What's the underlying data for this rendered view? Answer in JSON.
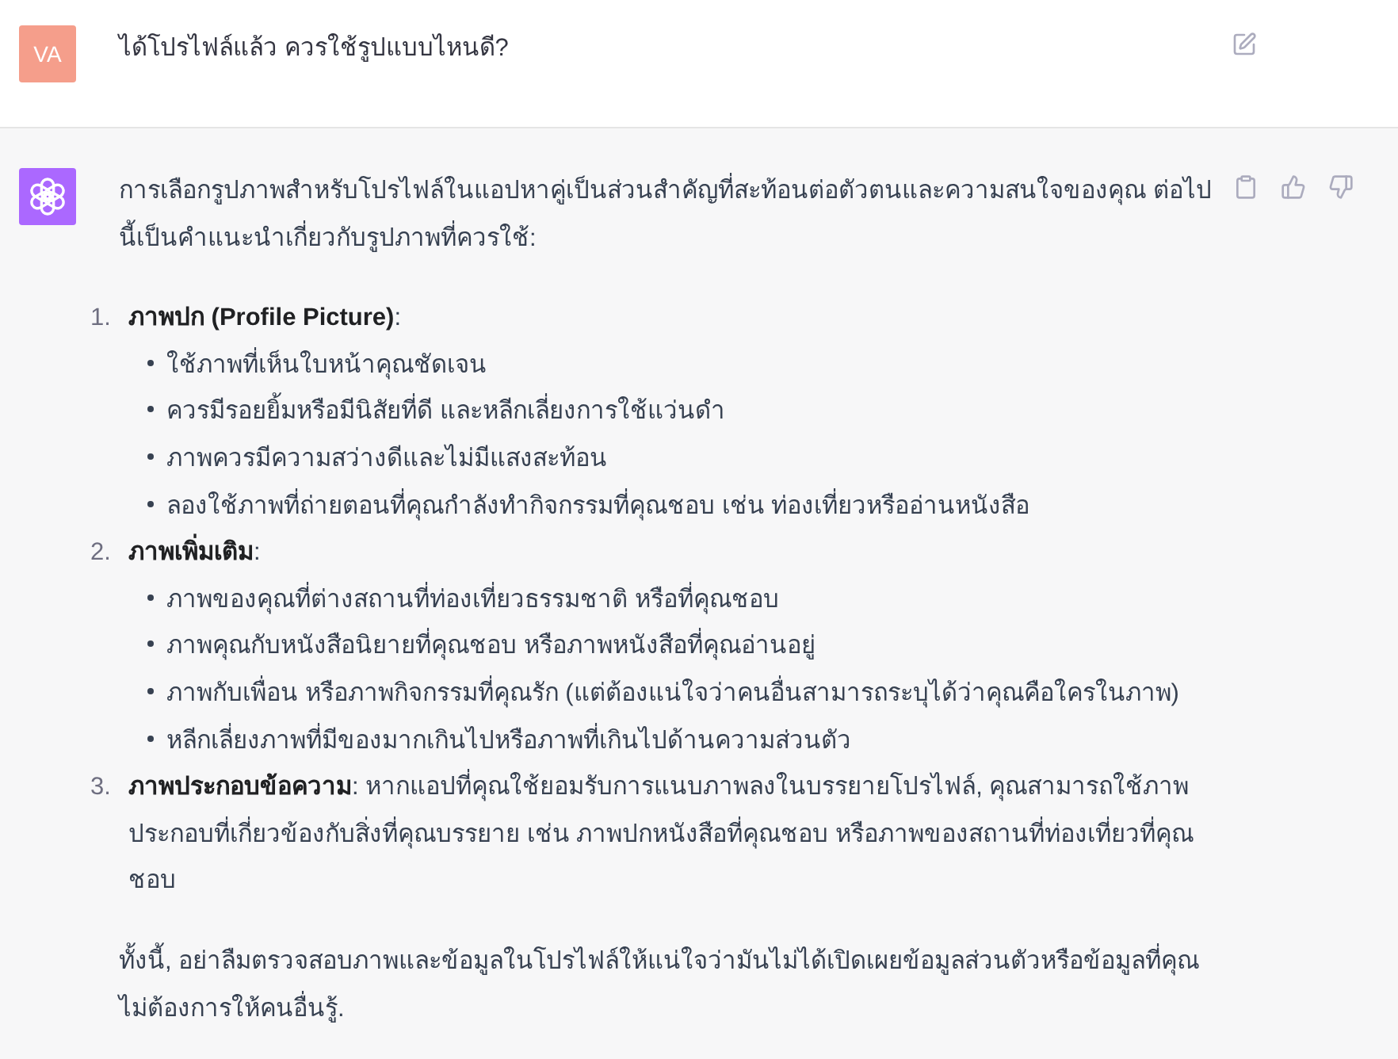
{
  "user_message": {
    "avatar": "VA",
    "text": "ได้โปรไฟล์แล้ว ควรใช้รูปแบบไหนดี?"
  },
  "assistant_message": {
    "intro": "การเลือกรูปภาพสำหรับโปรไฟล์ในแอปหาคู่เป็นส่วนสำคัญที่สะท้อนต่อตัวตนและความสนใจของคุณ ต่อไปนี้เป็นคำแนะนำเกี่ยวกับรูปภาพที่ควรใช้:",
    "list": [
      {
        "number": "1.",
        "text": "**ภาพปก (Profile Picture)**:",
        "bullets": [
          "ใช้ภาพที่เห็นใบหน้าคุณชัดเจน",
          "ควรมีรอยยิ้มหรือมีนิสัยที่ดี และหลีกเลี่ยงการใช้แว่นดำ",
          "ภาพควรมีความสว่างดีและไม่มีแสงสะท้อน",
          "ลองใช้ภาพที่ถ่ายตอนที่คุณกำลังทำกิจกรรมที่คุณชอบ เช่น ท่องเที่ยวหรืออ่านหนังสือ"
        ]
      },
      {
        "number": "2.",
        "text": "**ภาพเพิ่มเติม**:",
        "bullets": [
          "ภาพของคุณที่ต่างสถานที่ท่องเที่ยวธรรมชาติ หรือที่คุณชอบ",
          "ภาพคุณกับหนังสือนิยายที่คุณชอบ หรือภาพหนังสือที่คุณอ่านอยู่",
          "ภาพกับเพื่อน หรือภาพกิจกรรมที่คุณรัก (แต่ต้องแน่ใจว่าคนอื่นสามารถระบุได้ว่าคุณคือใครในภาพ)",
          "หลีกเลี่ยงภาพที่มีของมากเกินไปหรือภาพที่เกินไปด้านความส่วนตัว"
        ]
      },
      {
        "number": "3.",
        "text": "**ภาพประกอบข้อความ**: หากแอปที่คุณใช้ยอมรับการแนบภาพลงในบรรยายโปรไฟล์, คุณสามารถใช้ภาพประกอบที่เกี่ยวข้องกับสิ่งที่คุณบรรยาย เช่น ภาพปกหนังสือที่คุณชอบ หรือภาพของสถานที่ท่องเที่ยวที่คุณชอบ"
      }
    ],
    "closing": "ทั้งนี้, อย่าลืมตรวจสอบภาพและข้อมูลในโปรไฟล์ให้แน่ใจว่ามันไม่ได้เปิดเผยข้อมูลส่วนตัวหรือข้อมูลที่คุณไม่ต้องการให้คนอื่นรู้."
  }
}
